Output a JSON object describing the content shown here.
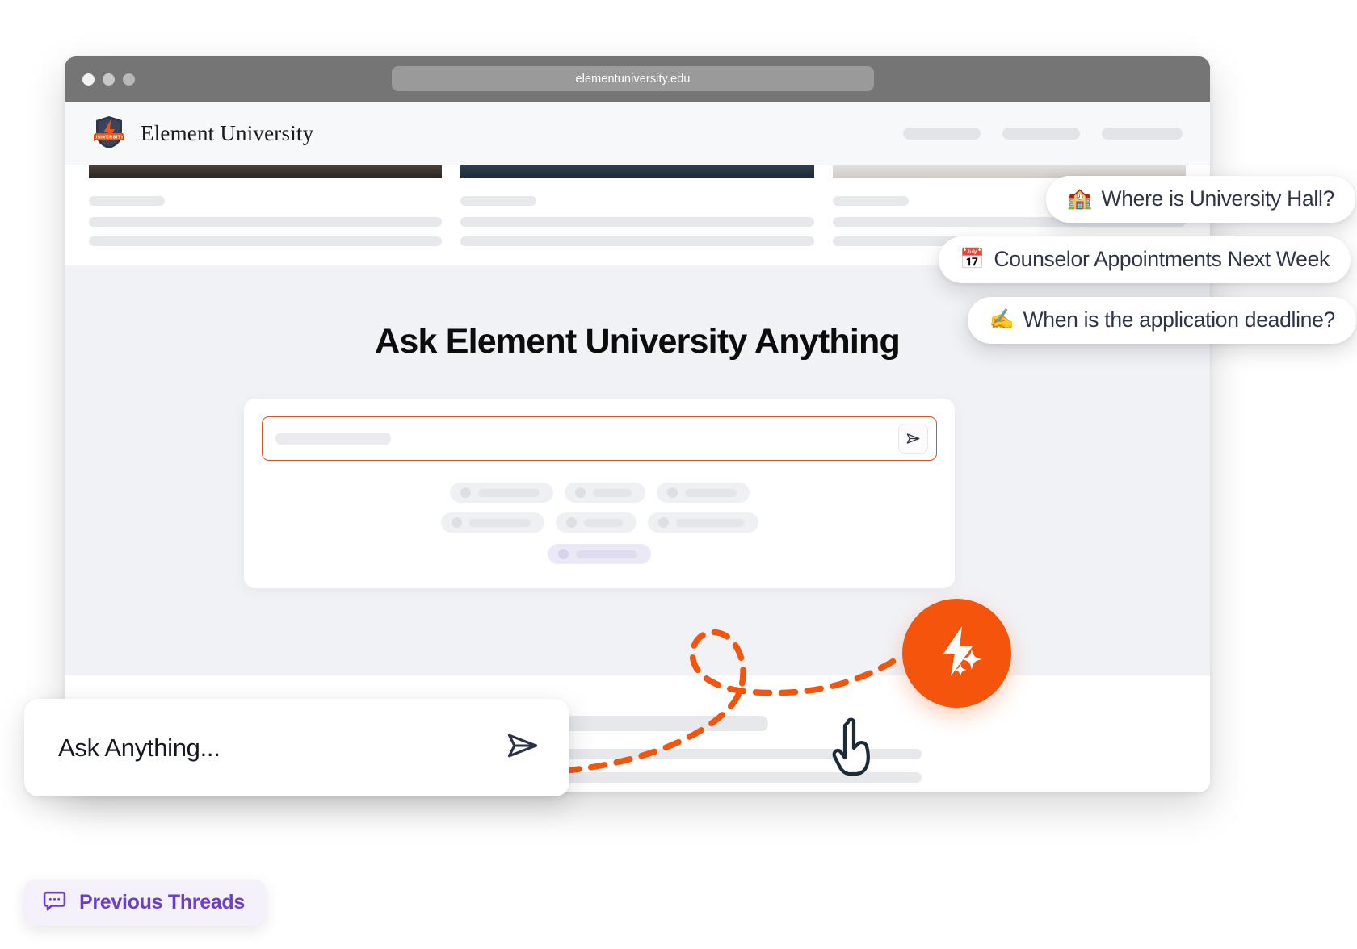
{
  "browser": {
    "url": "elementuniversity.edu",
    "traffic_lights": [
      "close",
      "minimize",
      "maximize"
    ]
  },
  "site_header": {
    "brand_name": "Element University",
    "logo_icon": "university-shield-lightning-logo",
    "logo_banner_text": "UNIVERSITY",
    "nav_placeholder_count": 3
  },
  "content_cards": [
    {
      "image": "campus-photo-1"
    },
    {
      "image": "campus-photo-2"
    },
    {
      "image": "campus-photo-3"
    }
  ],
  "hero": {
    "title": "Ask Element University Anything",
    "search": {
      "placeholder": "",
      "value": "",
      "send_icon": "send-paper-plane-icon",
      "border_color": "#d2541f"
    },
    "suggestion_chips_rows": [
      3,
      3,
      1
    ]
  },
  "question_bubbles": [
    {
      "emoji": "🏫",
      "emoji_name": "school-building-emoji",
      "text": "Where is University Hall?"
    },
    {
      "emoji": "📅",
      "emoji_name": "calendar-emoji",
      "text": "Counselor Appointments Next Week"
    },
    {
      "emoji": "✍️",
      "emoji_name": "writing-hand-emoji",
      "text": "When is the application deadline?"
    }
  ],
  "ask_card": {
    "placeholder": "Ask Anything...",
    "send_icon": "send-paper-plane-icon"
  },
  "threads_chip": {
    "label": "Previous Threads",
    "icon": "chat-bubble-dots-icon",
    "accent_color": "#6d3fc4"
  },
  "fab": {
    "icon": "lightning-sparkle-icon",
    "color": "#f4540c"
  },
  "cursor": {
    "icon": "pointing-hand-cursor"
  },
  "colors": {
    "accent_orange": "#f4540c",
    "input_border": "#d2541f",
    "purple": "#6d3fc4",
    "hero_bg": "#f1f2f6",
    "chrome_gray": "#757575"
  }
}
